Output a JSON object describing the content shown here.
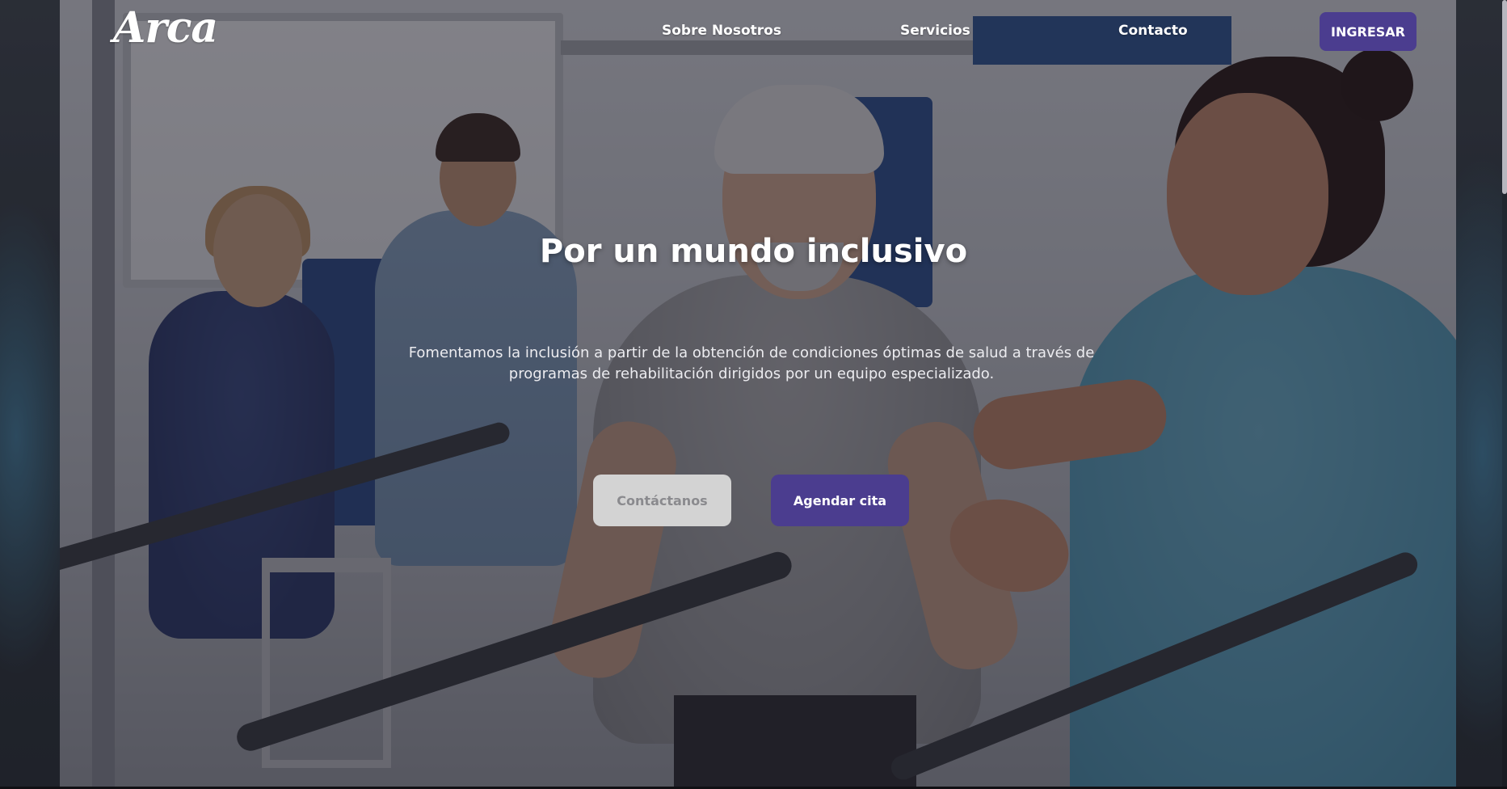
{
  "navbar": {
    "logo_text": "Arca",
    "links": [
      {
        "label": "Sobre Nosotros"
      },
      {
        "label": "Servicios"
      },
      {
        "label": "Contacto"
      }
    ],
    "login_label": "INGRESAR"
  },
  "hero": {
    "title": "Por un mundo inclusivo",
    "subtitle": "Fomentamos la inclusión a partir de la obtención de condiciones óptimas de salud a través de programas de rehabilitación dirigidos por un equipo especializado.",
    "contact_button": "Contáctanos",
    "appointment_button": "Agendar cita"
  },
  "colors": {
    "accent": "#4b3d8f",
    "secondary_button": "#d3d3d3"
  }
}
